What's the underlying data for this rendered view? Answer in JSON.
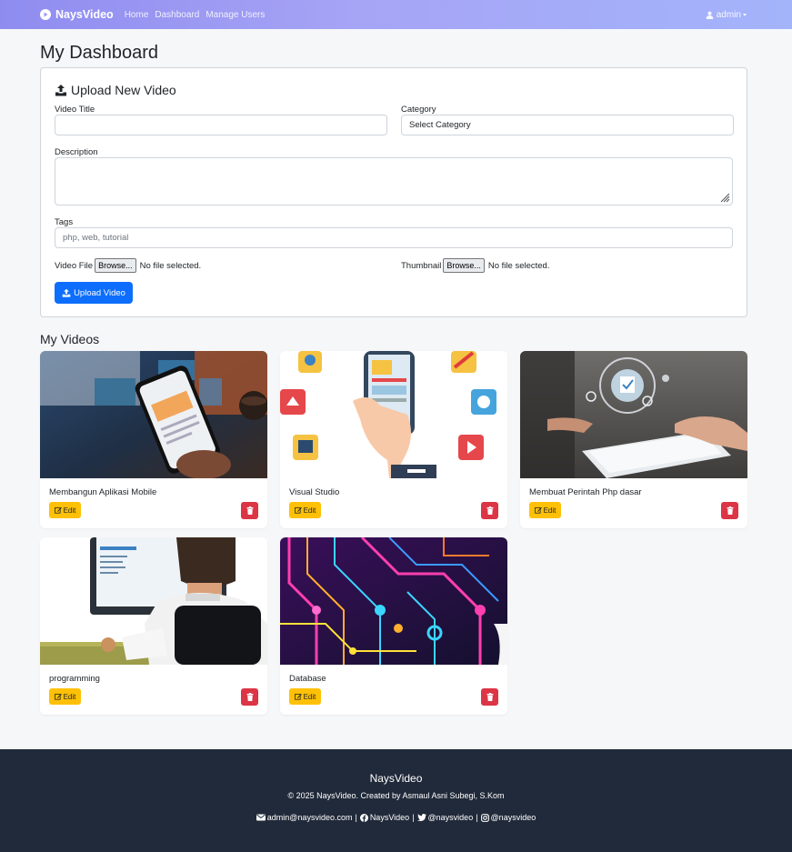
{
  "navbar": {
    "brand": "NaysVideo",
    "links": [
      "Home",
      "Dashboard",
      "Manage Users"
    ],
    "user": "admin"
  },
  "page_title": "My Dashboard",
  "upload": {
    "heading": "Upload New Video",
    "video_title_label": "Video Title",
    "video_title_value": "",
    "category_label": "Category",
    "category_value": "Select Category",
    "description_label": "Description",
    "description_value": "",
    "tags_label": "Tags",
    "tags_placeholder": "php, web, tutorial",
    "video_file_label": "Video File",
    "thumbnail_label": "Thumbnail",
    "browse_label": "Browse...",
    "no_file": "No file selected.",
    "submit_label": "Upload Video"
  },
  "videos_title": "My Videos",
  "videos": [
    {
      "title": "Membangun Aplikasi Mobile",
      "edit": "Edit"
    },
    {
      "title": "Visual Studio",
      "edit": "Edit"
    },
    {
      "title": "Membuat Perintah Php dasar",
      "edit": "Edit"
    },
    {
      "title": "programming",
      "edit": "Edit"
    },
    {
      "title": "Database",
      "edit": "Edit"
    }
  ],
  "footer": {
    "brand": "NaysVideo",
    "copyright": "© 2025 NaysVideo. Created by Asmaul Asni Subegi, S.Kom",
    "email": "admin@naysvideo.com",
    "facebook": "NaysVideo",
    "twitter": "@naysvideo",
    "instagram": "@naysvideo"
  },
  "colors": {
    "primary": "#0d6efd",
    "warning": "#ffc107",
    "danger": "#dc3545",
    "footer_bg": "#212a3a"
  }
}
